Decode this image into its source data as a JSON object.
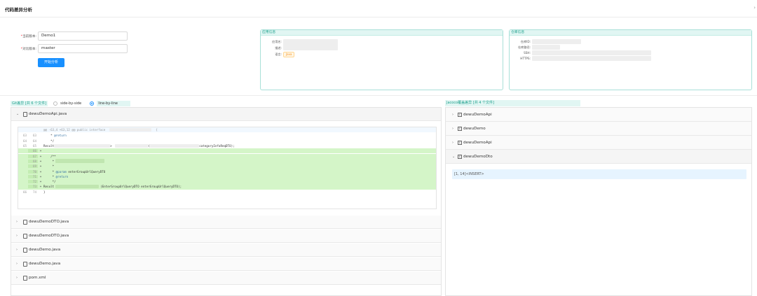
{
  "header": {
    "title": "代码差异分析",
    "close_icon": "›"
  },
  "form": {
    "current_label": "当前版本:",
    "current_value": "Demo1",
    "compare_label": "对比版本:",
    "compare_value": "master",
    "start_button": "开始分析"
  },
  "app_info": {
    "title": "应用信息",
    "name_label": "应用名:",
    "desc_label": "描述:",
    "lang_label": "语言:",
    "lang_value": "Java"
  },
  "repo_info": {
    "title": "仓库信息",
    "id_label": "仓库ID:",
    "path_label": "仓库路径:",
    "ssh_label": "SSH:",
    "https_label": "HTTPS:"
  },
  "git": {
    "title": "Git差异 [共 6 个文件]",
    "mode_side": "side-by-side",
    "mode_line": "line-by-line",
    "files": [
      {
        "name": "dewuDemoApi.java",
        "expanded": true
      },
      {
        "name": "dewuDemoDTO.java",
        "expanded": false
      },
      {
        "name": "dewuDemoDTO.java",
        "expanded": false
      },
      {
        "name": "dewuDemo.java",
        "expanded": false
      },
      {
        "name": "dewuDemo.java",
        "expanded": false
      },
      {
        "name": "pom.xml",
        "expanded": false
      }
    ]
  },
  "diff": {
    "hunk": "@@ -63,4 +63,12 @@ public interface",
    "lines": [
      {
        "o": "63",
        "n": "63",
        "pm": "",
        "text": "    * @return",
        "type": "ctx"
      },
      {
        "o": "64",
        "n": "64",
        "pm": "",
        "text": "    */",
        "type": "ctx"
      },
      {
        "o": "65",
        "n": "65",
        "pm": "",
        "text": "Result",
        "type": "ctx"
      },
      {
        "o": "",
        "n": "66",
        "pm": "+",
        "text": "",
        "type": "add"
      },
      {
        "o": "",
        "n": "67",
        "pm": "+",
        "text": "    /**",
        "type": "add"
      },
      {
        "o": "",
        "n": "68",
        "pm": "+",
        "text": "     *",
        "type": "add"
      },
      {
        "o": "",
        "n": "69",
        "pm": "+",
        "text": "     *",
        "type": "add"
      },
      {
        "o": "",
        "n": "70",
        "pm": "+",
        "text": "     * @param enterGroupUrlQueryDTO",
        "type": "add"
      },
      {
        "o": "",
        "n": "71",
        "pm": "+",
        "text": "     * @return",
        "type": "add"
      },
      {
        "o": "",
        "n": "72",
        "pm": "+",
        "text": "     */",
        "type": "add"
      },
      {
        "o": "",
        "n": "73",
        "pm": "+",
        "text": "Result<EnterGroupUrlDTO>",
        "type": "add"
      },
      {
        "o": "66",
        "n": "74",
        "pm": "",
        "text": "}",
        "type": "ctx"
      }
    ],
    "line65_mid1": ">",
    "line65_mid2": "(",
    "line65_tail": "categoryInfoReqDTO);",
    "line73_tail": "(EnterGroupUrlQueryDTO enterGroupUrlQueryDTO);",
    "brace": "{"
  },
  "jacoco": {
    "title": "Jacoco覆盖差异 [共 4 个文件]",
    "files": [
      {
        "name": "dewuDemoApi",
        "expanded": false
      },
      {
        "name": "dewuDemo",
        "expanded": false
      },
      {
        "name": "dewuDemoApi",
        "expanded": false
      },
      {
        "name": "dewuDemoDto",
        "expanded": true
      }
    ],
    "result": "[1, 14]<INSERT>"
  }
}
